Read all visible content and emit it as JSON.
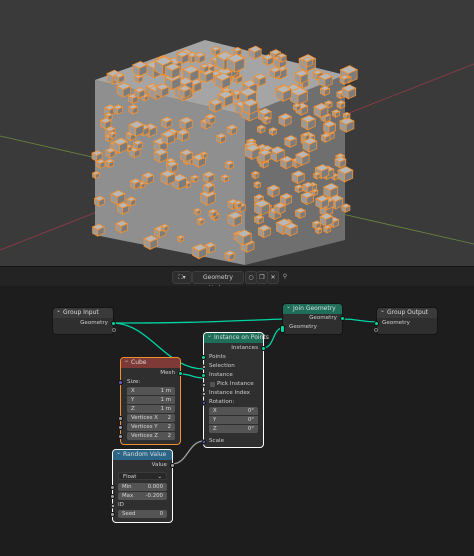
{
  "editor": {
    "tree_name": "Geometry Nodes"
  },
  "nodes": {
    "group_input": {
      "title": "Group Input",
      "outputs": [
        "Geometry"
      ]
    },
    "group_output": {
      "title": "Group Output",
      "inputs": [
        "Geometry"
      ]
    },
    "join_geometry": {
      "title": "Join Geometry",
      "output": "Geometry",
      "input": "Geometry"
    },
    "instance_on_points": {
      "title": "Instance on Points",
      "output": "Instances",
      "inputs": {
        "points": "Points",
        "selection": "Selection",
        "instance": "Instance",
        "pick_instance": "Pick Instance",
        "instance_index": "Instance Index",
        "rotation": "Rotation:",
        "scale": "Scale"
      },
      "rotation": [
        {
          "axis": "X",
          "value": "0°"
        },
        {
          "axis": "Y",
          "value": "0°"
        },
        {
          "axis": "Z",
          "value": "0°"
        }
      ]
    },
    "cube": {
      "title": "Cube",
      "output": "Mesh",
      "size_label": "Size:",
      "size": [
        {
          "axis": "X",
          "value": "1 m"
        },
        {
          "axis": "Y",
          "value": "1 m"
        },
        {
          "axis": "Z",
          "value": "1 m"
        }
      ],
      "vertices": [
        {
          "label": "Vertices X",
          "value": "2"
        },
        {
          "label": "Vertices Y",
          "value": "2"
        },
        {
          "label": "Vertices Z",
          "value": "2"
        }
      ]
    },
    "random_value": {
      "title": "Random Value",
      "output": "Value",
      "type": "Float",
      "min": {
        "label": "Min",
        "value": "0.000"
      },
      "max": {
        "label": "Max",
        "value": "-0.200"
      },
      "id_label": "ID",
      "seed": {
        "label": "Seed",
        "value": "0"
      }
    }
  },
  "colors": {
    "geometry_socket": "#00d6a3",
    "vector_socket": "#6363c7",
    "float_socket": "#a1a1a1",
    "selection_outline": "#f29030",
    "viewport_bg": "#3a3a3a",
    "node_editor_bg": "#1d1d1d"
  }
}
